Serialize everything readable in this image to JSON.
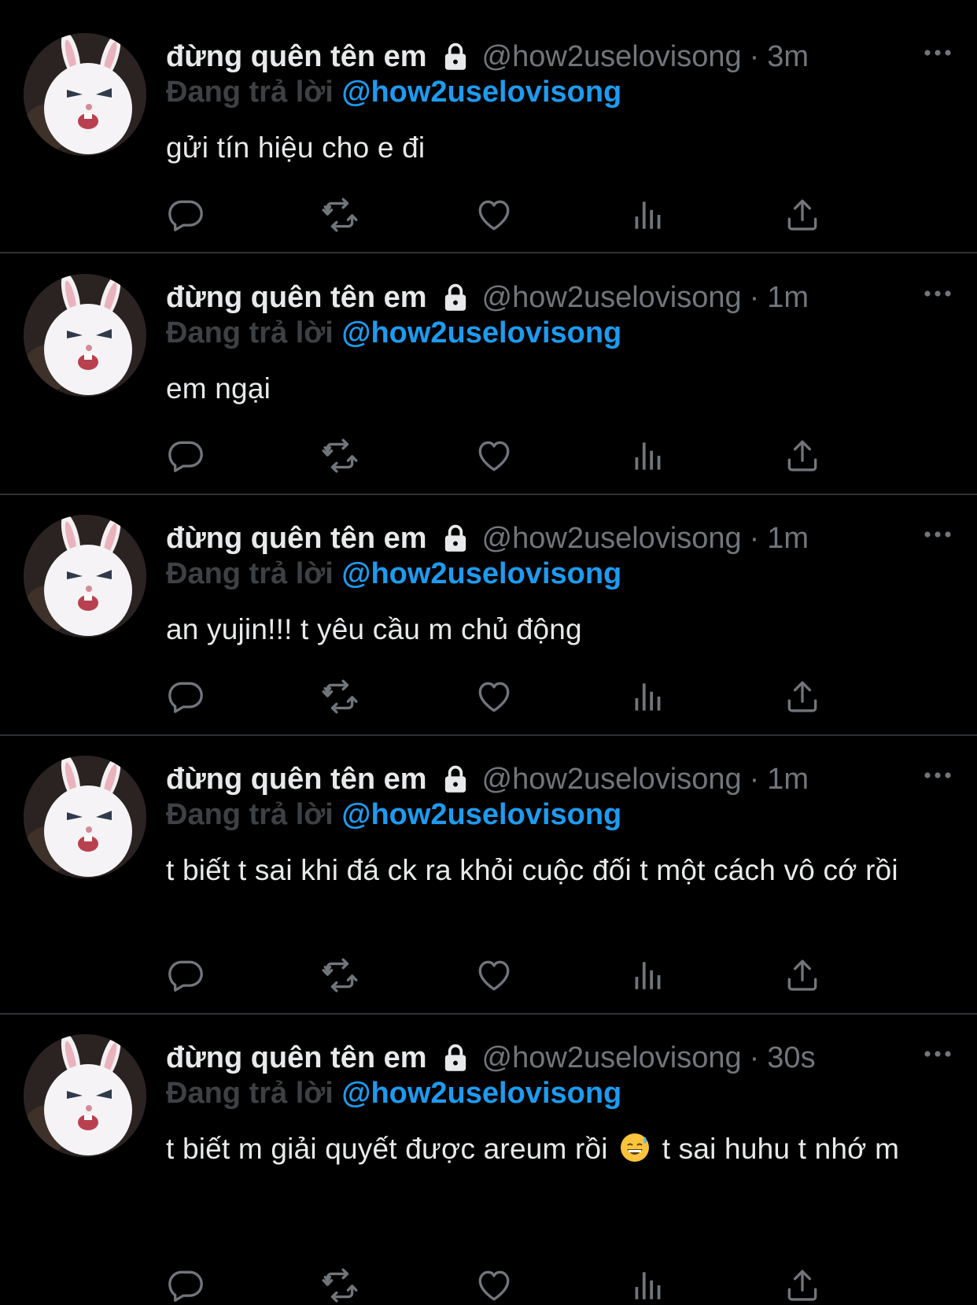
{
  "colors": {
    "background": "#000000",
    "text": "#e7e9ea",
    "muted": "#71767b",
    "reply_prefix": "#3e4144",
    "link": "#1d9bf0",
    "divider": "#2f3336"
  },
  "tweets": [
    {
      "name": "đừng quên tên em",
      "lock_icon": "lock-icon",
      "handle": "@how2uselovisong",
      "time": "3m",
      "reply_prefix": "Đang trả lời",
      "reply_handle": "@how2uselovisong",
      "text": "gửi tín hiệu cho e đi",
      "avatar": "white-bunny-avatar"
    },
    {
      "name": "đừng quên tên em",
      "lock_icon": "lock-icon",
      "handle": "@how2uselovisong",
      "time": "1m",
      "reply_prefix": "Đang trả lời",
      "reply_handle": "@how2uselovisong",
      "text": "em ngại",
      "avatar": "white-bunny-avatar"
    },
    {
      "name": "đừng quên tên em",
      "lock_icon": "lock-icon",
      "handle": "@how2uselovisong",
      "time": "1m",
      "reply_prefix": "Đang trả lời",
      "reply_handle": "@how2uselovisong",
      "text": "an yujin!!! t yêu cầu m chủ động",
      "avatar": "white-bunny-avatar"
    },
    {
      "name": "đừng quên tên em",
      "lock_icon": "lock-icon",
      "handle": "@how2uselovisong",
      "time": "1m",
      "reply_prefix": "Đang trả lời",
      "reply_handle": "@how2uselovisong",
      "text": "t biết t sai khi đá ck ra khỏi cuộc đối t một cách vô cớ rồi",
      "avatar": "white-bunny-avatar"
    },
    {
      "name": "đừng quên tên em",
      "lock_icon": "lock-icon",
      "handle": "@how2uselovisong",
      "time": "30s",
      "reply_prefix": "Đang trả lời",
      "reply_handle": "@how2uselovisong",
      "text_before_emoji": "t biết m giải quyết được areum rồi",
      "emoji": "grinning-sweat-emoji",
      "text_after_emoji": " t sai huhu t nhớ m",
      "avatar": "white-bunny-avatar"
    }
  ],
  "action_icons": [
    "reply-icon",
    "retweet-icon",
    "like-icon",
    "views-icon",
    "share-icon"
  ],
  "separator": "·"
}
